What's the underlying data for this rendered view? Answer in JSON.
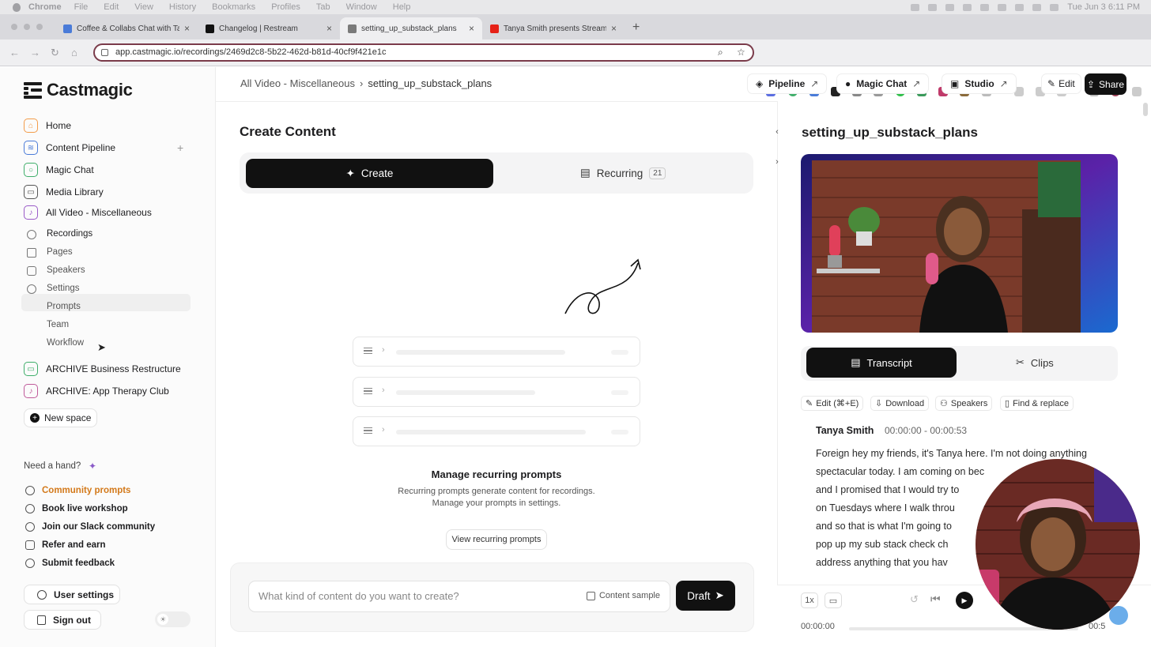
{
  "menubar": {
    "app_name": "Chrome",
    "items": [
      "File",
      "Edit",
      "View",
      "History",
      "Bookmarks",
      "Profiles",
      "Tab",
      "Window",
      "Help"
    ],
    "clock": "Tue Jun 3  6:11 PM"
  },
  "tabs": [
    {
      "title": "Coffee & Collabs Chat with Ta",
      "favicon_color": "#4a7bd8"
    },
    {
      "title": "Changelog | Restream",
      "favicon_color": "#111111"
    },
    {
      "title": "setting_up_substack_plans",
      "favicon_color": "#7a7a7a"
    },
    {
      "title": "Tanya Smith presents Stream",
      "favicon_color": "#e62117"
    }
  ],
  "address_bar": {
    "url": "app.castmagic.io/recordings/2469d2c8-5b22-462d-b81d-40cf9f421e1c"
  },
  "sidebar": {
    "logo_text": "Castmagic",
    "primary": [
      {
        "label": "Home",
        "icon": "home-icon",
        "color": "#f39c4a"
      },
      {
        "label": "Content Pipeline",
        "icon": "layers-icon",
        "color": "#4a7bd8"
      },
      {
        "label": "Magic Chat",
        "icon": "chat-icon",
        "color": "#3fae6a"
      },
      {
        "label": "Media Library",
        "icon": "folder-icon",
        "color": "#555555"
      }
    ],
    "space_name": "All Video - Miscellaneous",
    "space_items": [
      "Recordings",
      "Pages",
      "Speakers",
      "Settings"
    ],
    "settings_sub": [
      "Prompts",
      "Team",
      "Workflow"
    ],
    "archives": [
      "ARCHIVE Business Restructure",
      "ARCHIVE: App Therapy Club"
    ],
    "new_space_label": "New space",
    "need_hand": "Need a hand?",
    "community_prompts": "Community prompts",
    "links": [
      "Book live workshop",
      "Join our Slack community",
      "Refer and earn",
      "Submit feedback"
    ],
    "user_settings": "User settings",
    "sign_out": "Sign out"
  },
  "header": {
    "crumb_space": "All Video - Miscellaneous",
    "crumb_current": "setting_up_substack_plans",
    "pipeline": "Pipeline",
    "magic_chat": "Magic Chat",
    "studio": "Studio",
    "edit": "Edit",
    "share": "Share"
  },
  "create": {
    "title": "Create Content",
    "tab_create": "Create",
    "tab_recurring": "Recurring",
    "recurring_count": "21",
    "manage_title": "Manage recurring prompts",
    "manage_desc1": "Recurring prompts generate content for recordings.",
    "manage_desc2": "Manage your prompts in settings.",
    "view_button": "View recurring prompts",
    "input_placeholder": "What kind of content do you want to create?",
    "content_sample": "Content sample",
    "draft": "Draft"
  },
  "recording": {
    "title": "setting_up_substack_plans",
    "tab_transcript": "Transcript",
    "tab_clips": "Clips",
    "tools": [
      "Edit (⌘+E)",
      "Download",
      "Speakers",
      "Find & replace"
    ],
    "speaker": "Tanya Smith",
    "timestamp": "00:00:00 - 00:00:53",
    "transcript_lines": [
      "Foreign hey my friends, it's Tanya here. I'm not doing anything",
      "spectacular today. I am coming on bec",
      "and I promised that I would try to",
      "on Tuesdays where I walk throu",
      "and so that is what I'm going to",
      "pop up my sub stack check ch",
      "address anything that you hav"
    ],
    "speed": "1x",
    "current_time": "00:00:00",
    "end_time_partial": "00:5"
  }
}
